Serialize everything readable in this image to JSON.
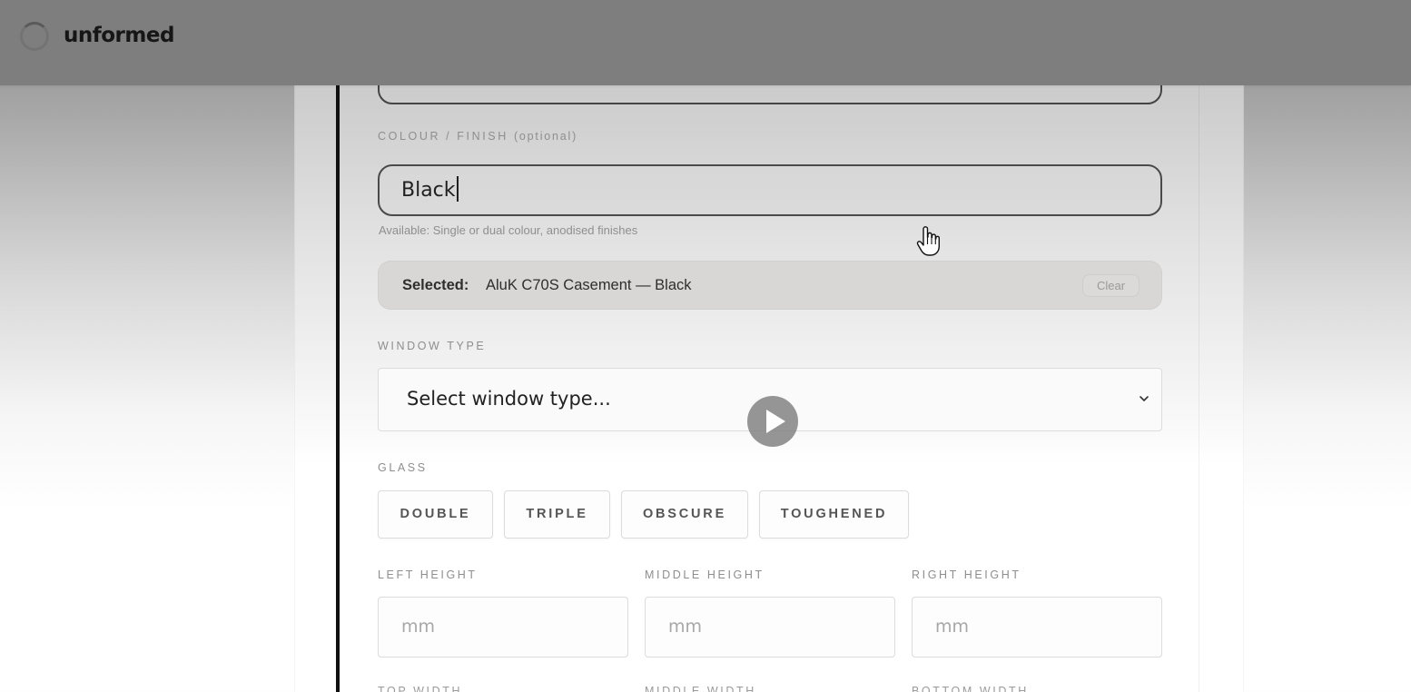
{
  "app": {
    "brand": "unformed",
    "spinner_icon": "loading-spinner-icon"
  },
  "form": {
    "colour": {
      "label": "COLOUR / FINISH",
      "label_optional": "(optional)",
      "value": "Black",
      "hint": "Available: Single or dual colour, anodised finishes"
    },
    "selected": {
      "label": "Selected:",
      "value": "AluK C70S Casement — Black",
      "clear_label": "Clear"
    },
    "window_type": {
      "label": "WINDOW TYPE",
      "placeholder": "Select window type...",
      "chevron_icon": "chevron-down-icon"
    },
    "glass": {
      "label": "GLASS",
      "options": [
        "DOUBLE",
        "TRIPLE",
        "OBSCURE",
        "TOUGHENED"
      ]
    },
    "heights": {
      "left_label": "LEFT HEIGHT",
      "middle_label": "MIDDLE HEIGHT",
      "right_label": "RIGHT HEIGHT",
      "placeholder": "mm"
    },
    "widths_partial": [
      "TOP WIDTH",
      "MIDDLE WIDTH",
      "BOTTOM WIDTH"
    ]
  },
  "overlay": {
    "play_icon": "play-icon",
    "cursor_icon": "hand-pointer-cursor-icon"
  },
  "colors": {
    "header_bg": "#7e7e7e",
    "accent_bar": "#111111",
    "selected_bg": "#d9d7d5"
  }
}
